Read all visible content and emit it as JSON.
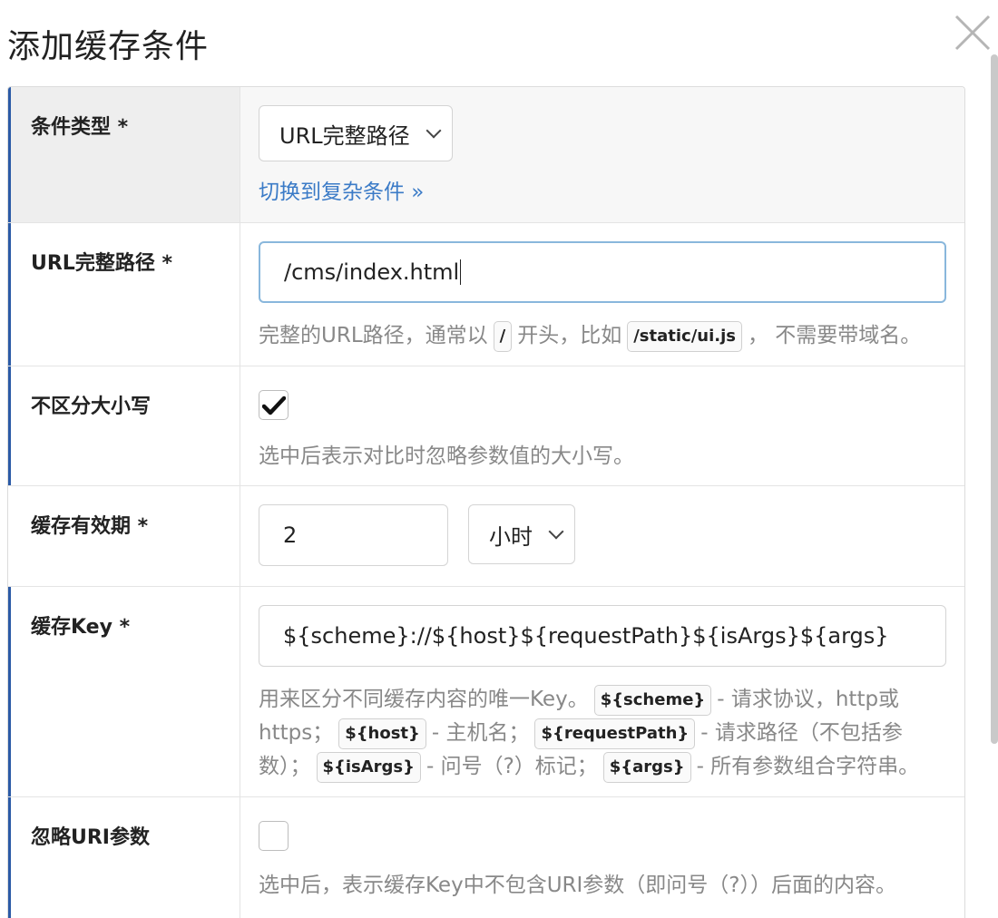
{
  "dialog": {
    "title": "添加缓存条件"
  },
  "rows": {
    "cond_type": {
      "label": "条件类型 *",
      "select_value": "URL完整路径",
      "switch_link": "切换到复杂条件 »"
    },
    "url_path": {
      "label": "URL完整路径 *",
      "input_value": "/cms/index.html",
      "help_prefix": "完整的URL路径，通常以",
      "code_slash": "/",
      "help_mid": "开头，比如",
      "code_example": "/static/ui.js",
      "help_suffix": "， 不需要带域名。"
    },
    "case_insensitive": {
      "label": "不区分大小写",
      "checked": true,
      "help": "选中后表示对比时忽略参数值的大小写。"
    },
    "cache_ttl": {
      "label": "缓存有效期 *",
      "value": "2",
      "unit": "小时"
    },
    "cache_key": {
      "label": "缓存Key *",
      "input_value": "${scheme}://${host}${requestPath}${isArgs}${args}",
      "help_1": "用来区分不同缓存内容的唯一Key。",
      "code_scheme": "${scheme}",
      "help_2": "- 请求协议，http或https；",
      "code_host": "${host}",
      "help_3": "- 主机名；",
      "code_request_path": "${requestPath}",
      "help_4": "- 请求路径（不包括参数）；",
      "code_is_args": "${isArgs}",
      "help_5": "- 问号（?）标记；",
      "code_args": "${args}",
      "help_6": "- 所有参数组合字符串。"
    },
    "ignore_uri_args": {
      "label": "忽略URI参数",
      "checked": false,
      "help": "选中后，表示缓存Key中不包含URI参数（即问号（?））后面的内容。"
    }
  }
}
